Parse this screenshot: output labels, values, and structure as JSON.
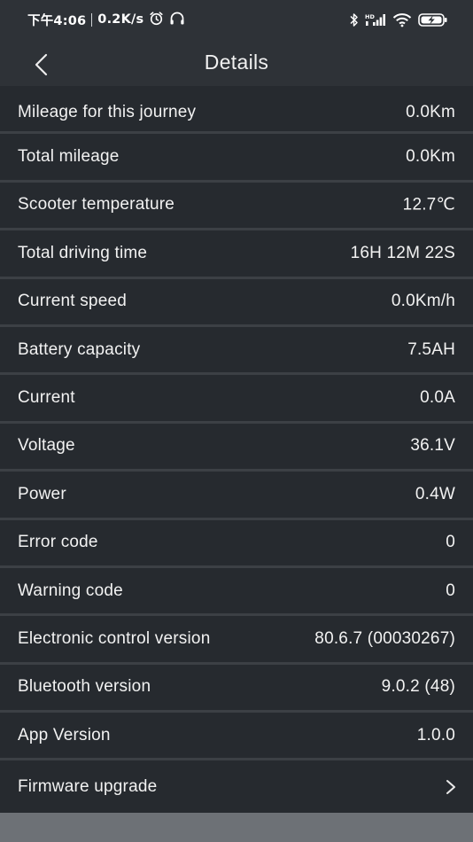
{
  "status_bar": {
    "time": "下午4:06",
    "network_speed": "0.2K/s",
    "icons": [
      "alarm-icon",
      "headset-icon",
      "bluetooth-icon",
      "hd-signal-icon",
      "wifi-icon",
      "battery-charging-icon"
    ]
  },
  "header": {
    "title": "Details",
    "back_icon": "chevron-left-icon"
  },
  "details": [
    {
      "label": "Mileage for this journey",
      "value": "0.0Km"
    },
    {
      "label": "Total mileage",
      "value": "0.0Km"
    },
    {
      "label": "Scooter temperature",
      "value": "12.7℃"
    },
    {
      "label": "Total driving time",
      "value": "16H 12M 22S"
    },
    {
      "label": "Current speed",
      "value": "0.0Km/h"
    },
    {
      "label": "Battery capacity",
      "value": "7.5AH"
    },
    {
      "label": "Current",
      "value": "0.0A"
    },
    {
      "label": "Voltage",
      "value": "36.1V"
    },
    {
      "label": "Power",
      "value": "0.4W"
    },
    {
      "label": "Error code",
      "value": "0"
    },
    {
      "label": "Warning code",
      "value": "0"
    },
    {
      "label": "Electronic control version",
      "value": "80.6.7 (00030267)"
    },
    {
      "label": "Bluetooth version",
      "value": "9.0.2 (48)"
    },
    {
      "label": "App Version",
      "value": "1.0.0"
    }
  ],
  "firmware": {
    "label": "Firmware upgrade",
    "icon": "chevron-right-icon"
  },
  "colors": {
    "background": "#2b2f34",
    "row_background": "#262a2f",
    "divider": "#3c4045",
    "text": "#f2f2f2",
    "battery_accent": "#ffffff"
  }
}
